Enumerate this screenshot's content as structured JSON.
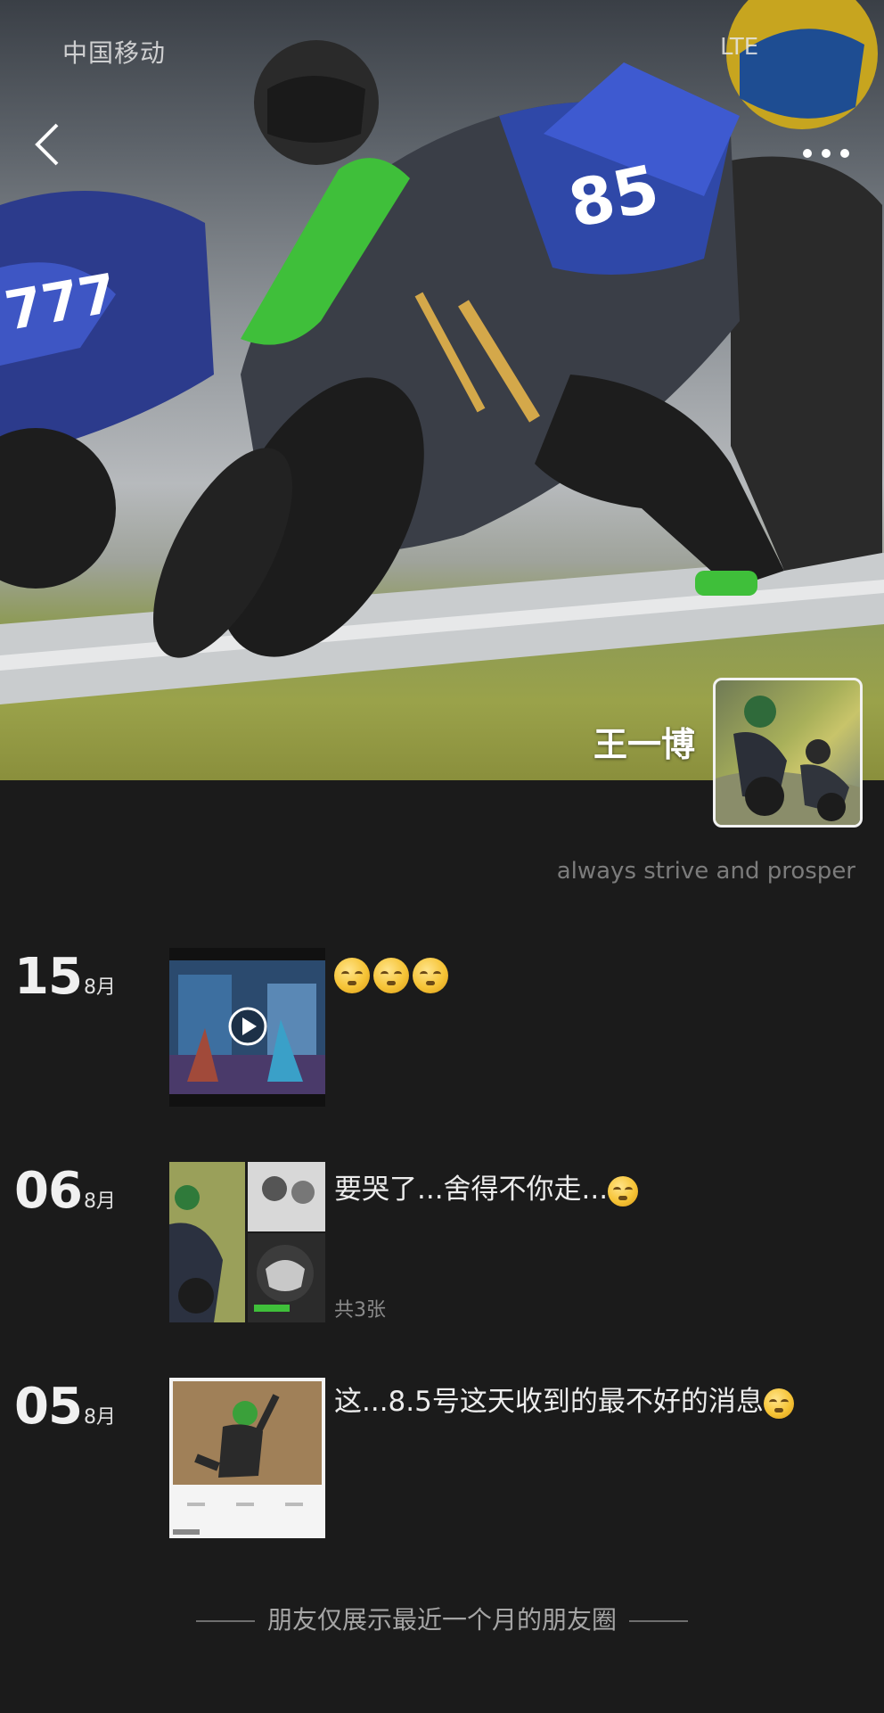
{
  "status_bar": {
    "carrier": "中国移动",
    "network": "LTE"
  },
  "profile": {
    "name": "王一博",
    "signature": "always strive and prosper"
  },
  "icons": {
    "back": "chevron-left-icon",
    "more": "more-dots-icon",
    "play": "play-icon"
  },
  "posts": [
    {
      "day": "15",
      "month": "8月",
      "text": "",
      "emoji_count": 3,
      "media": "video"
    },
    {
      "day": "06",
      "month": "8月",
      "text": "要哭了...舍得不你走...",
      "emoji_count": 1,
      "media": "images",
      "photo_count": "共3张"
    },
    {
      "day": "05",
      "month": "8月",
      "text": "这...8.5号这天收到的最不好的消息",
      "emoji_count": 1,
      "media": "image"
    }
  ],
  "footer": {
    "text": "朋友仅展示最近一个月的朋友圈"
  },
  "colors": {
    "background": "#1b1b1b",
    "text": "#ececec",
    "muted": "#7c7c7c"
  }
}
